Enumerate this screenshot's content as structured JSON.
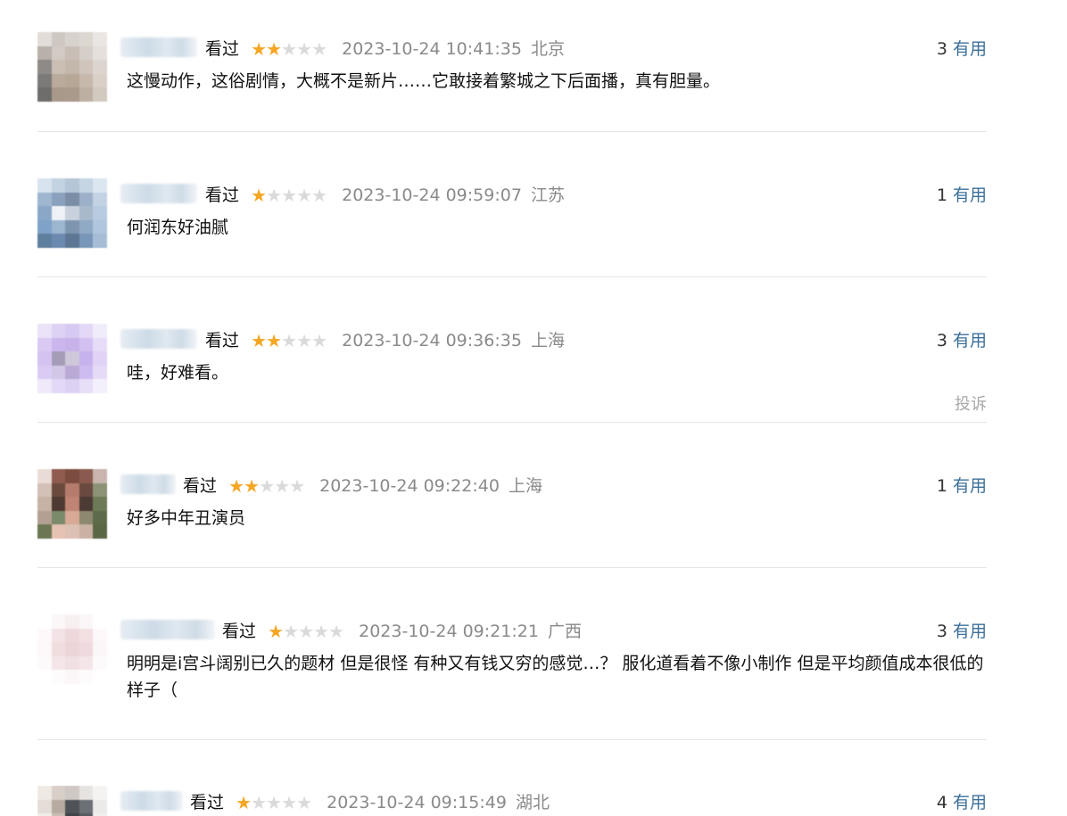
{
  "reviews": [
    {
      "watched_label": "看过",
      "rating": 2,
      "time": "2023-10-24 10:41:35",
      "location": "北京",
      "useful_count": "3",
      "useful_label": "有用",
      "content": "这慢动作，这俗剧情，大概不是新片……它敢接着繁城之下后面播，真有胆量。"
    },
    {
      "watched_label": "看过",
      "rating": 1,
      "time": "2023-10-24 09:59:07",
      "location": "江苏",
      "useful_count": "1",
      "useful_label": "有用",
      "content": "何润东好油腻"
    },
    {
      "watched_label": "看过",
      "rating": 2,
      "time": "2023-10-24 09:36:35",
      "location": "上海",
      "useful_count": "3",
      "useful_label": "有用",
      "content": "哇，好难看。",
      "report_label": "投诉"
    },
    {
      "watched_label": "看过",
      "rating": 2,
      "time": "2023-10-24 09:22:40",
      "location": "上海",
      "useful_count": "1",
      "useful_label": "有用",
      "content": "好多中年丑演员"
    },
    {
      "watched_label": "看过",
      "rating": 1,
      "time": "2023-10-24 09:21:21",
      "location": "广西",
      "useful_count": "3",
      "useful_label": "有用",
      "content": "明明是i宫斗阔别已久的题材 但是很怪 有种又有钱又穷的感觉…？ 服化道看着不像小制作 但是平均颜值成本很低的样子（"
    },
    {
      "watched_label": "看过",
      "rating": 1,
      "time": "2023-10-24 09:15:49",
      "location": "湖北",
      "useful_count": "4",
      "useful_label": "有用",
      "content": ""
    }
  ],
  "colors": {
    "star_on": "#f5a623",
    "star_off": "#dadada",
    "link": "#3b6f9a",
    "muted": "#8a8a8a"
  }
}
